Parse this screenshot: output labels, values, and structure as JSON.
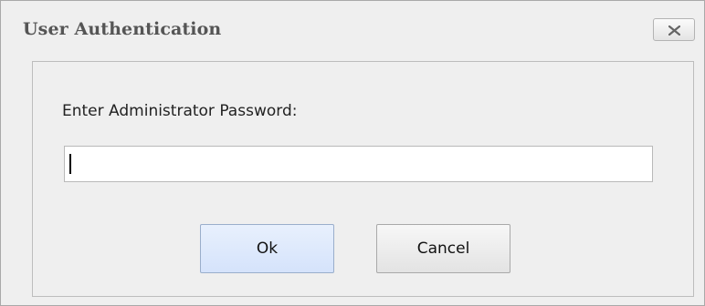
{
  "window": {
    "title": "User Authentication",
    "close_icon": "close-icon"
  },
  "form": {
    "prompt": "Enter Administrator Password:",
    "password_value": "",
    "password_placeholder": ""
  },
  "buttons": {
    "ok_label": "Ok",
    "cancel_label": "Cancel"
  },
  "colors": {
    "dialog_background": "#efefef",
    "title_text": "#555555",
    "ok_button_fill": "#d9e6fb"
  }
}
